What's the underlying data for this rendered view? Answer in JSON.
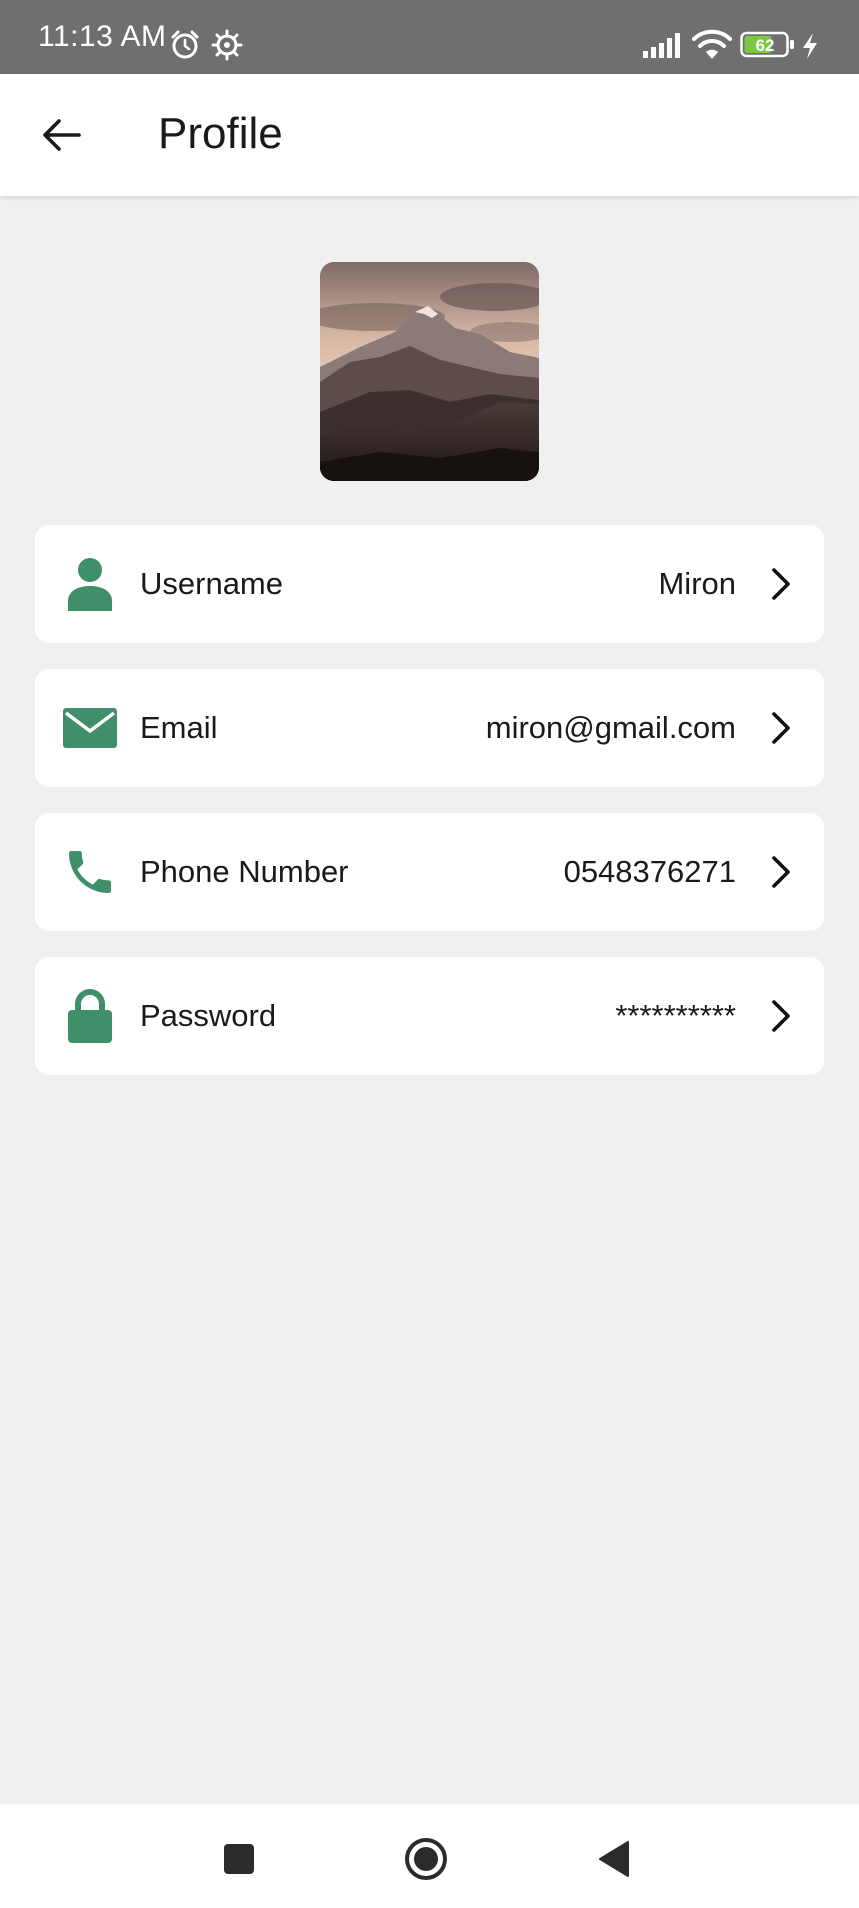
{
  "status_bar": {
    "time": "11:13 AM",
    "battery_level": "62",
    "icons": [
      "alarm-icon",
      "settings-icon",
      "signal-icon",
      "wifi-icon",
      "battery-icon",
      "charging-icon"
    ]
  },
  "app_bar": {
    "title": "Profile",
    "back_icon": "arrow-left-icon"
  },
  "avatar": {
    "description_icon": "mountain-photo"
  },
  "profile_items": [
    {
      "label": "Username",
      "value": "Miron",
      "icon": "person-icon"
    },
    {
      "label": "Email",
      "value": "miron@gmail.com",
      "icon": "envelope-icon"
    },
    {
      "label": "Phone Number",
      "value": "0548376271",
      "icon": "phone-icon"
    },
    {
      "label": "Password",
      "value": "**********",
      "icon": "lock-icon"
    }
  ],
  "nav_bar": {
    "buttons": [
      "recents-square-icon",
      "home-circle-icon",
      "back-triangle-icon"
    ]
  },
  "colors": {
    "accent": "#3f8f6b",
    "status_bar": "#6f6f6f",
    "background": "#f0f0f0",
    "battery_fill": "#7ac943"
  }
}
